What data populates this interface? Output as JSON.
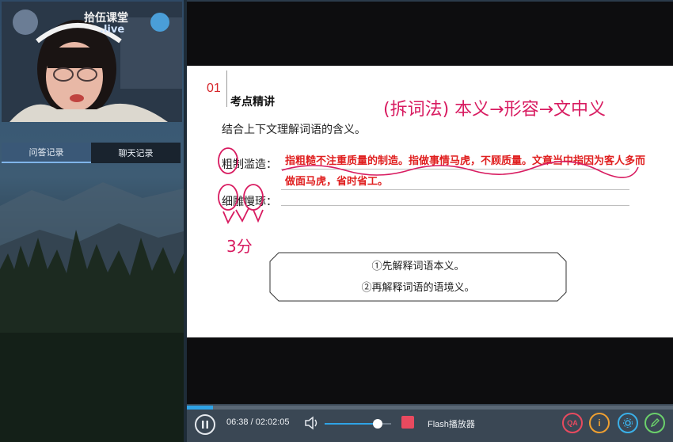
{
  "webcam": {
    "logo_text": "拾伍课堂",
    "logo_sub": ".live"
  },
  "tabs": {
    "qa_label": "问答记录",
    "chat_label": "聊天记录"
  },
  "slide": {
    "number": "01",
    "title": "考点精讲",
    "instruction": "结合上下文理解词语的含义。",
    "term1": "粗制滥造：",
    "term1_answer": "指粗糙不注重质量的制造。指做事情马虎，不顾质量。文章当中指因为客人多而做面马虎，省时省工。",
    "term2": "细雕慢琢：",
    "method_1": "①先解释词语本义。",
    "method_2": "②再解释词语的语境义。",
    "handwriting": {
      "note": "(拆词法) 本义→形容→文中义",
      "score": "3分"
    }
  },
  "player": {
    "time": "06:38 / 02:02:05",
    "progress": 0.054,
    "volume": 0.8,
    "flash_label": "Flash播放器",
    "qa_icon_text": "QA",
    "info_icon_text": "i",
    "accent": "#2fa3e6"
  }
}
